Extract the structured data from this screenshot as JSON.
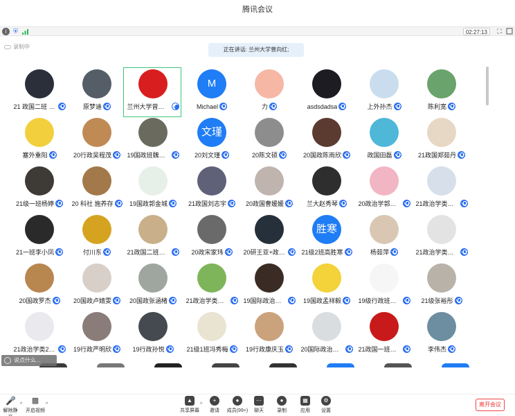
{
  "window": {
    "title": "腾讯会议"
  },
  "status": {
    "timer": "02:27:13",
    "info_icon": "info-icon",
    "shield_icon": "shield-icon",
    "signal_icon": "signal-icon"
  },
  "recording": {
    "label": "录制中"
  },
  "speaking": {
    "text": "正在讲话: 兰州大学曾向红;"
  },
  "participants": [
    {
      "name": "21 政国二班 刘...",
      "bg": "#2b2f3a",
      "mic": "muted"
    },
    {
      "name": "原梦迪",
      "bg": "#555d66",
      "mic": "muted"
    },
    {
      "name": "兰州大学曾向红",
      "bg": "#d81e1e",
      "mic": "on",
      "active": true
    },
    {
      "name": "Michael",
      "bg": "#1f7df5",
      "letter": "M",
      "mic": "muted"
    },
    {
      "name": "力",
      "bg": "#f6b7a5",
      "mic": "muted"
    },
    {
      "name": "asdsdadsa",
      "bg": "#1c1c22",
      "mic": "muted"
    },
    {
      "name": "上外孙杰",
      "bg": "#c9ddef",
      "mic": "muted"
    },
    {
      "name": "陈利宽",
      "bg": "#6aa36b",
      "mic": "muted"
    },
    {
      "name": "塞外重阳",
      "bg": "#f2cf3c",
      "mic": "muted"
    },
    {
      "name": "20行政吴程茂",
      "bg": "#c08a55",
      "mic": "muted"
    },
    {
      "name": "19国政班魏周新龙",
      "bg": "#6b6a5e",
      "mic": "muted"
    },
    {
      "name": "20刘文瑾",
      "bg": "#1f7df5",
      "letter": "文瑾",
      "mic": "muted"
    },
    {
      "name": "20陈文硕",
      "bg": "#8d8d8d",
      "mic": "muted"
    },
    {
      "name": "20国政陈雨欣",
      "bg": "#5b3a30",
      "mic": "muted"
    },
    {
      "name": "政国田磊",
      "bg": "#4fb7d8",
      "mic": "muted"
    },
    {
      "name": "21政国郑茹丹",
      "bg": "#e7d7c5",
      "mic": "muted"
    },
    {
      "name": "21级一班杨婷",
      "bg": "#3e3a36",
      "mic": "muted"
    },
    {
      "name": "20 科社 施养存",
      "bg": "#a3784a",
      "mic": "muted"
    },
    {
      "name": "19国政郭金城",
      "bg": "#e7efe9",
      "mic": "muted"
    },
    {
      "name": "21政国刘志宇",
      "bg": "#5f6178",
      "mic": "muted"
    },
    {
      "name": "20政国曹媛媛",
      "bg": "#bfb4ae",
      "mic": "muted"
    },
    {
      "name": "兰大赵秀琴",
      "bg": "#2e2e2e",
      "mic": "muted"
    },
    {
      "name": "20政治学郭玉朵",
      "bg": "#f2b5c3",
      "mic": "muted"
    },
    {
      "name": "21政治学类二班...",
      "bg": "#d7dfea",
      "mic": "muted"
    },
    {
      "name": "21一班李小凤",
      "bg": "#2a2a2a",
      "mic": "muted"
    },
    {
      "name": "付川东",
      "bg": "#d6a320",
      "mic": "muted"
    },
    {
      "name": "21政国二班李辉",
      "bg": "#c9b08a",
      "mic": "muted"
    },
    {
      "name": "20政宋家玮",
      "bg": "#6a6a6a",
      "mic": "muted"
    },
    {
      "name": "20研王亚+政国院",
      "bg": "#25303a",
      "mic": "muted"
    },
    {
      "name": "21级2班高胜寒",
      "bg": "#1f7df5",
      "letter": "胜寒",
      "mic": "muted"
    },
    {
      "name": "杨茹萍",
      "bg": "#d9c7b4",
      "mic": "muted"
    },
    {
      "name": "21政治学类二班张...",
      "bg": "#e3e3e3",
      "mic": "muted"
    },
    {
      "name": "20国政罗杰",
      "bg": "#b8864f",
      "mic": "muted"
    },
    {
      "name": "20国政卢婧雯",
      "bg": "#d8d0c8",
      "mic": "muted"
    },
    {
      "name": "20国政张涵楮",
      "bg": "#9fa6a0",
      "mic": "muted"
    },
    {
      "name": "21政治学类二班...",
      "bg": "#7fb55a",
      "mic": "muted"
    },
    {
      "name": "19国际政治薛纪澜",
      "bg": "#3a2c24",
      "mic": "muted"
    },
    {
      "name": "19国政孟祥毅",
      "bg": "#f3d23a",
      "mic": "muted"
    },
    {
      "name": "19级行政班叶尔...",
      "bg": "#f6f6f6",
      "mic": "muted"
    },
    {
      "name": "21级张裕彤",
      "bg": "#b9b2a9",
      "mic": "muted"
    },
    {
      "name": "21政治学类2班...",
      "bg": "#e9e9ee",
      "mic": "muted"
    },
    {
      "name": "19行政严明欣",
      "bg": "#8a7d79",
      "mic": "muted"
    },
    {
      "name": "19行政孙悦",
      "bg": "#444a50",
      "mic": "muted"
    },
    {
      "name": "21级1班冯秀梅",
      "bg": "#e9e3d2",
      "mic": "muted"
    },
    {
      "name": "19行政康庆玉",
      "bg": "#caa27c",
      "mic": "muted"
    },
    {
      "name": "20国际政治王侃年",
      "bg": "#d9dde0",
      "mic": "muted"
    },
    {
      "name": "21政国一班梁宵华",
      "bg": "#c81a1a",
      "mic": "muted"
    },
    {
      "name": "李伟杰",
      "bg": "#6d8da0",
      "mic": "muted"
    }
  ],
  "chat": {
    "placeholder": "说点什么..."
  },
  "toolbar": {
    "unmute": "解除静音",
    "video": "开启视频",
    "share": "共享屏幕",
    "invite": "邀请",
    "members": "成员(99+)",
    "chat": "聊天",
    "record": "录制",
    "apps": "应用",
    "settings": "设置",
    "leave": "离开会议"
  }
}
